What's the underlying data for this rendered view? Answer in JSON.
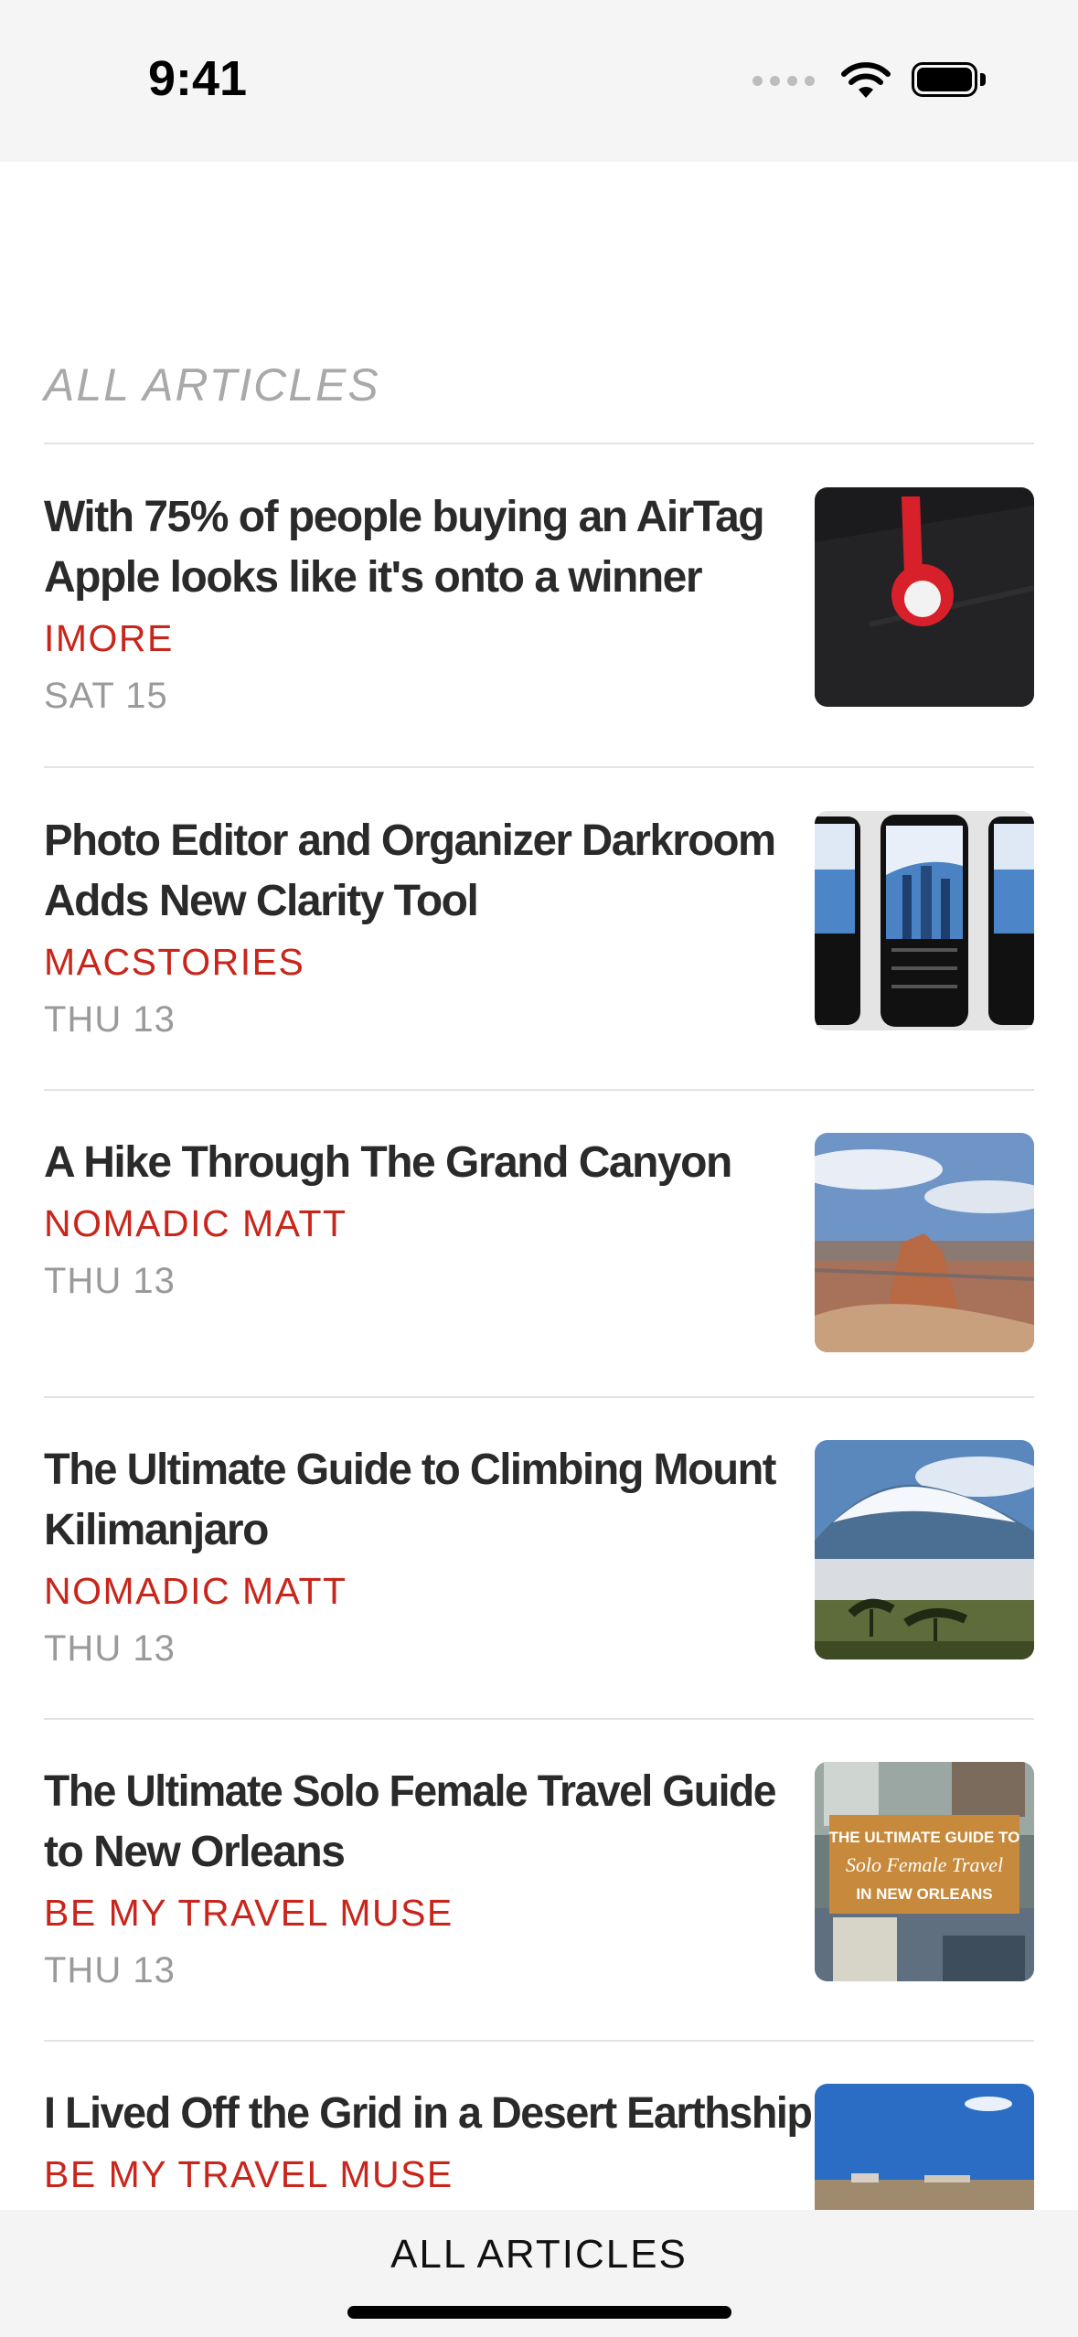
{
  "status_bar": {
    "time": "9:41"
  },
  "header": {
    "section_title": "ALL ARTICLES"
  },
  "articles": [
    {
      "title_line1": "With 75% of people buying an AirTag",
      "title_line2": "Apple looks like it's onto a winner",
      "source": "IMORE",
      "date": "SAT 15",
      "thumbnail": "airtag-image"
    },
    {
      "title_line1": "Photo Editor and Organizer Darkroom",
      "title_line2": "Adds New Clarity Tool",
      "source": "MACSTORIES",
      "date": "THU 13",
      "thumbnail": "darkroom-screens-image"
    },
    {
      "title_line1": "A Hike Through The Grand Canyon",
      "title_line2": "",
      "source": "NOMADIC MATT",
      "date": "THU 13",
      "thumbnail": "grand-canyon-image"
    },
    {
      "title_line1": "The Ultimate Guide to Climbing Mount",
      "title_line2": "Kilimanjaro",
      "source": "NOMADIC MATT",
      "date": "THU 13",
      "thumbnail": "kilimanjaro-image"
    },
    {
      "title_line1": "The Ultimate Solo Female Travel Guide",
      "title_line2": "to New Orleans",
      "source": "BE MY TRAVEL MUSE",
      "date": "THU 13",
      "thumbnail": "new-orleans-image",
      "thumbnail_text": [
        "THE ULTIMATE GUIDE TO",
        "Solo Female Travel",
        "IN NEW ORLEANS"
      ]
    },
    {
      "title_line1": "I Lived Off the Grid in a Desert Earthship",
      "title_line2": "",
      "source": "BE MY TRAVEL MUSE",
      "date": "",
      "thumbnail": "desert-earthship-image"
    }
  ],
  "tab_bar": {
    "label": "ALL ARTICLES"
  },
  "colors": {
    "accent": "#c8261c",
    "title": "#2a2a2a",
    "muted": "#9a9a9a",
    "section": "#a9a9a9"
  }
}
